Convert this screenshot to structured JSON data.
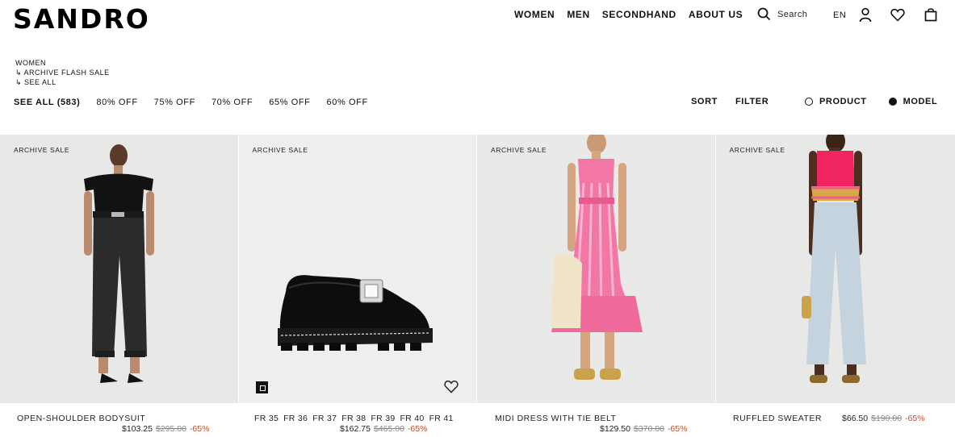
{
  "brand": "SANDRO",
  "nav": [
    "WOMEN",
    "MEN",
    "SECONDHAND",
    "ABOUT US"
  ],
  "search_label": "Search",
  "language": "EN",
  "breadcrumb": [
    "WOMEN",
    "↳ ARCHIVE FLASH SALE",
    "↳ SEE ALL"
  ],
  "filters": {
    "all": "SEE ALL (583)",
    "options": [
      "80% OFF",
      "75% OFF",
      "70% OFF",
      "65% OFF",
      "60% OFF"
    ]
  },
  "sort_label": "SORT",
  "filter_label": "FILTER",
  "view": {
    "product": "PRODUCT",
    "model": "MODEL",
    "selected": "MODEL"
  },
  "products": [
    {
      "tag": "ARCHIVE SALE",
      "name": "OPEN-SHOULDER BODYSUIT",
      "price": "$103.25",
      "old_price": "$295.00",
      "discount": "-65%"
    },
    {
      "tag": "ARCHIVE SALE",
      "name": "",
      "sizes": [
        "FR 35",
        "FR 36",
        "FR 37",
        "FR 38",
        "FR 39",
        "FR 40",
        "FR 41"
      ],
      "price": "$162.75",
      "old_price": "$465.00",
      "discount": "-65%"
    },
    {
      "tag": "ARCHIVE SALE",
      "name": "MIDI DRESS WITH TIE BELT",
      "price": "$129.50",
      "old_price": "$370.00",
      "discount": "-65%"
    },
    {
      "tag": "ARCHIVE SALE",
      "name": "RUFFLED SWEATER",
      "price": "$66.50",
      "old_price": "$190.00",
      "discount": "-65%"
    }
  ],
  "colors": {
    "discount": "#d0451b",
    "card_bg": "#e7e7e5"
  },
  "icons": [
    "search-icon",
    "account-icon",
    "heart-icon",
    "bag-icon",
    "wishlist-icon",
    "color-swatch-icon"
  ]
}
